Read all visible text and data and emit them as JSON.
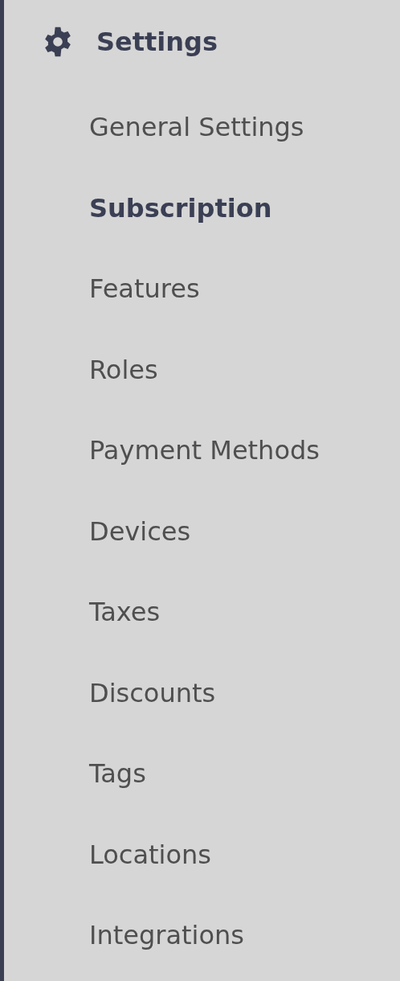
{
  "section": {
    "title": "Settings"
  },
  "items": [
    {
      "label": "General Settings",
      "selected": false
    },
    {
      "label": "Subscription",
      "selected": true
    },
    {
      "label": "Features",
      "selected": false
    },
    {
      "label": "Roles",
      "selected": false
    },
    {
      "label": "Payment Methods",
      "selected": false
    },
    {
      "label": "Devices",
      "selected": false
    },
    {
      "label": "Taxes",
      "selected": false
    },
    {
      "label": "Discounts",
      "selected": false
    },
    {
      "label": "Tags",
      "selected": false
    },
    {
      "label": "Locations",
      "selected": false
    },
    {
      "label": "Integrations",
      "selected": false
    }
  ]
}
